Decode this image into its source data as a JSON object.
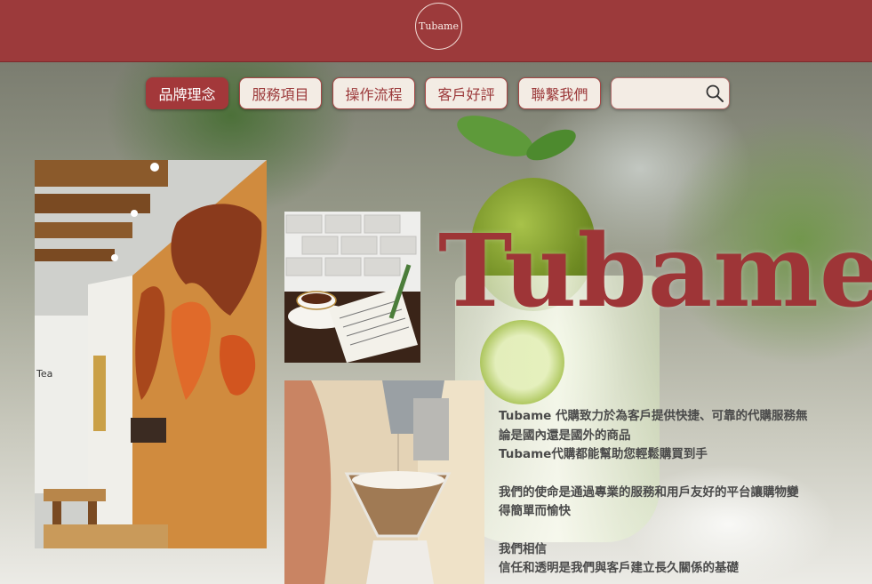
{
  "header": {
    "logo_text": "Tubame"
  },
  "nav": {
    "items": [
      {
        "label": "品牌理念",
        "active": true
      },
      {
        "label": "服務項目",
        "active": false
      },
      {
        "label": "操作流程",
        "active": false
      },
      {
        "label": "客戶好評",
        "active": false
      },
      {
        "label": "聯繫我們",
        "active": false
      }
    ],
    "search": {
      "value": "",
      "placeholder": "",
      "icon": "search-icon"
    }
  },
  "hero": {
    "title": "Tubame",
    "paragraphs": [
      [
        "Tubame 代購致力於為客戶提供快捷、可靠的代購服務無",
        "論是國內還是國外的商品",
        "Tubame代購都能幫助您輕鬆購買到手"
      ],
      [
        "我們的使命是通過專業的服務和用戶友好的平台讓購物變",
        "得簡單而愉快"
      ],
      [
        "我們相信",
        "信任和透明是我們與客戶建立長久關係的基礎"
      ]
    ]
  },
  "colors": {
    "brand": "#9c3a3b",
    "nav_bg": "#f3ece4",
    "text": "#4a4a4a"
  }
}
